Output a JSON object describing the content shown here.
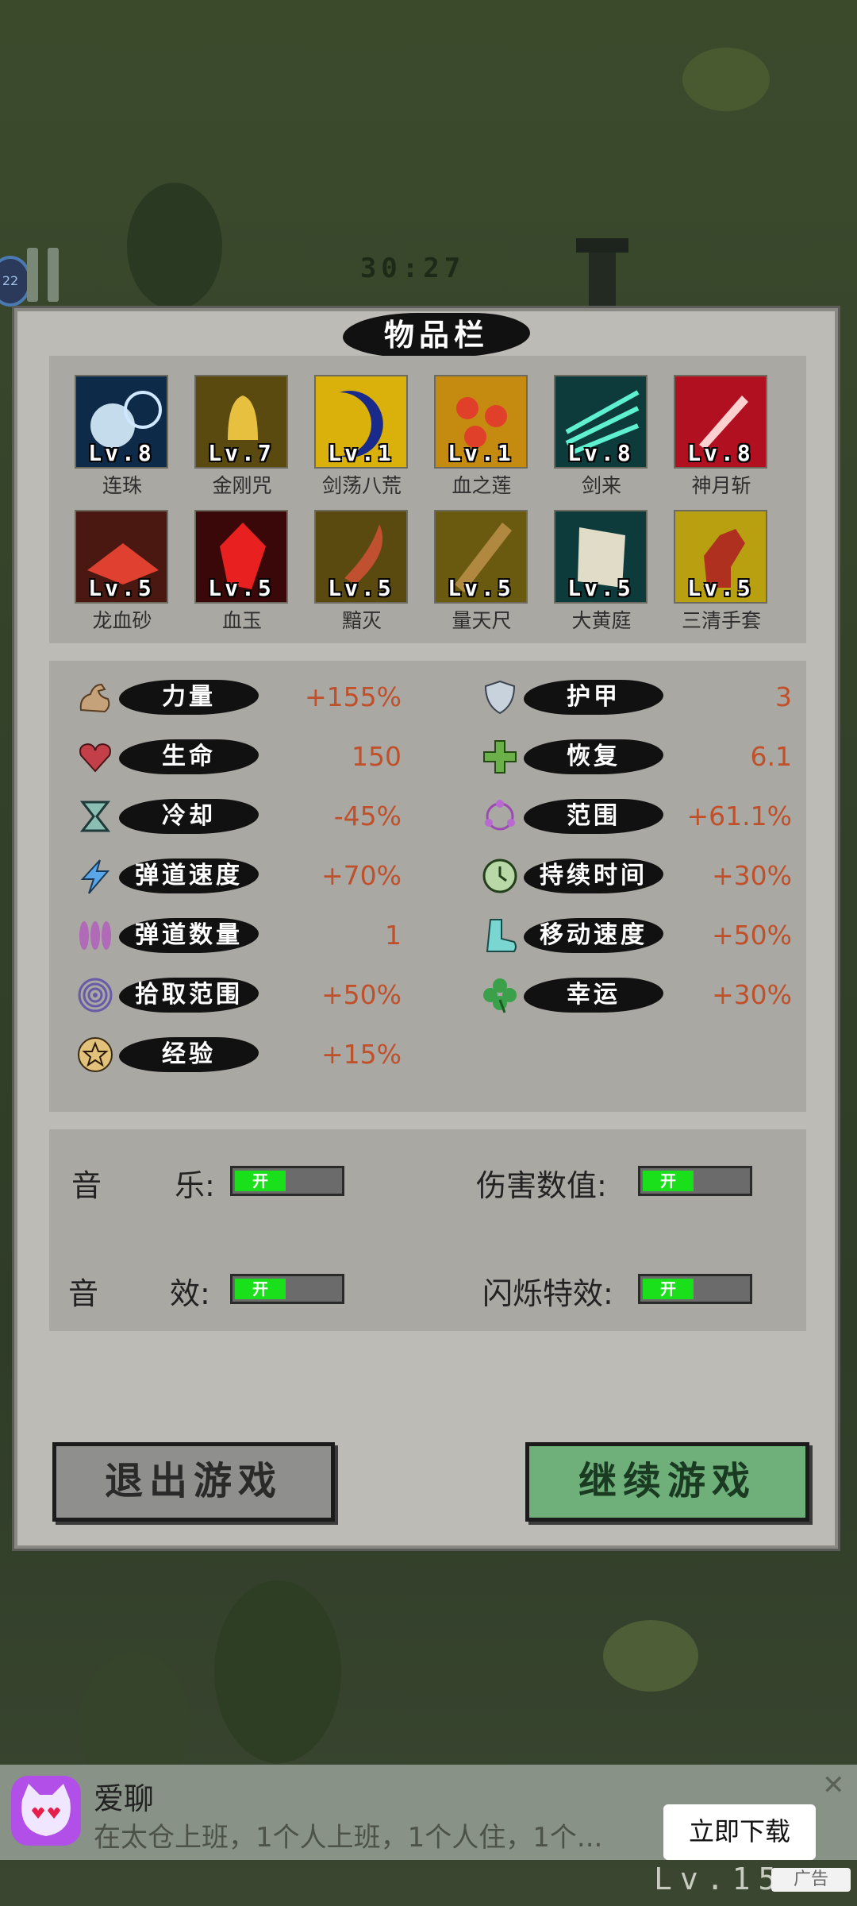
{
  "hud": {
    "timer": "30:27",
    "level_badge": "22",
    "bottom_level": "Lv.15"
  },
  "panel": {
    "title": "物品栏"
  },
  "items": [
    {
      "name": "连珠",
      "level": "Lv.8",
      "colors": [
        "#0d2a48",
        "#8fd0ff"
      ]
    },
    {
      "name": "金刚咒",
      "level": "Lv.7",
      "colors": [
        "#5a4a10",
        "#e8c040"
      ]
    },
    {
      "name": "剑荡八荒",
      "level": "Lv.1",
      "colors": [
        "#d9b10a",
        "#1a2a8a"
      ]
    },
    {
      "name": "血之莲",
      "level": "Lv.1",
      "colors": [
        "#c58a10",
        "#e0402a"
      ]
    },
    {
      "name": "剑来",
      "level": "Lv.8",
      "colors": [
        "#0d3a3a",
        "#5ef0d0"
      ]
    },
    {
      "name": "神月斩",
      "level": "Lv.8",
      "colors": [
        "#b01020",
        "#ff8a8a"
      ]
    },
    {
      "name": "龙血砂",
      "level": "Lv.5",
      "colors": [
        "#4a1810",
        "#e04030"
      ]
    },
    {
      "name": "血玉",
      "level": "Lv.5",
      "colors": [
        "#3a0808",
        "#e82020"
      ]
    },
    {
      "name": "黯灭",
      "level": "Lv.5",
      "colors": [
        "#5a4a10",
        "#c05030"
      ]
    },
    {
      "name": "量天尺",
      "level": "Lv.5",
      "colors": [
        "#6a5a10",
        "#b08840"
      ]
    },
    {
      "name": "大黄庭",
      "level": "Lv.5",
      "colors": [
        "#0d3a3a",
        "#e0dcc8"
      ]
    },
    {
      "name": "三清手套",
      "level": "Lv.5",
      "colors": [
        "#b8a010",
        "#b03020"
      ]
    }
  ],
  "stats_left": [
    {
      "label": "力量",
      "value": "+155%",
      "icon": "muscle-icon"
    },
    {
      "label": "生命",
      "value": "150",
      "icon": "heart-icon"
    },
    {
      "label": "冷却",
      "value": "-45%",
      "icon": "hourglass-icon"
    },
    {
      "label": "弹道速度",
      "value": "+70%",
      "icon": "lightning-icon"
    },
    {
      "label": "弹道数量",
      "value": "1",
      "icon": "projectiles-icon"
    },
    {
      "label": "拾取范围",
      "value": "+50%",
      "icon": "spiral-icon"
    },
    {
      "label": "经验",
      "value": "+15%",
      "icon": "star-icon"
    }
  ],
  "stats_right": [
    {
      "label": "护甲",
      "value": "3",
      "icon": "shield-icon"
    },
    {
      "label": "恢复",
      "value": "6.1",
      "icon": "plus-icon"
    },
    {
      "label": "范围",
      "value": "+61.1%",
      "icon": "range-icon"
    },
    {
      "label": "持续时间",
      "value": "+30%",
      "icon": "clock-icon"
    },
    {
      "label": "移动速度",
      "value": "+50%",
      "icon": "boot-icon"
    },
    {
      "label": "幸运",
      "value": "+30%",
      "icon": "clover-icon"
    }
  ],
  "settings": {
    "music_label_a": "音",
    "music_label_b": "乐:",
    "sfx_label_a": "音",
    "sfx_label_b": "效:",
    "damage_label": "伤害数值:",
    "flash_label": "闪烁特效:",
    "toggle_on_text": "开"
  },
  "buttons": {
    "exit": "退出游戏",
    "continue": "继续游戏"
  },
  "ad": {
    "title": "爱聊",
    "description": "在太仓上班，1个人上班，1个人住，1个...",
    "cta": "立即下载",
    "close": "✕",
    "tag": "广告"
  }
}
